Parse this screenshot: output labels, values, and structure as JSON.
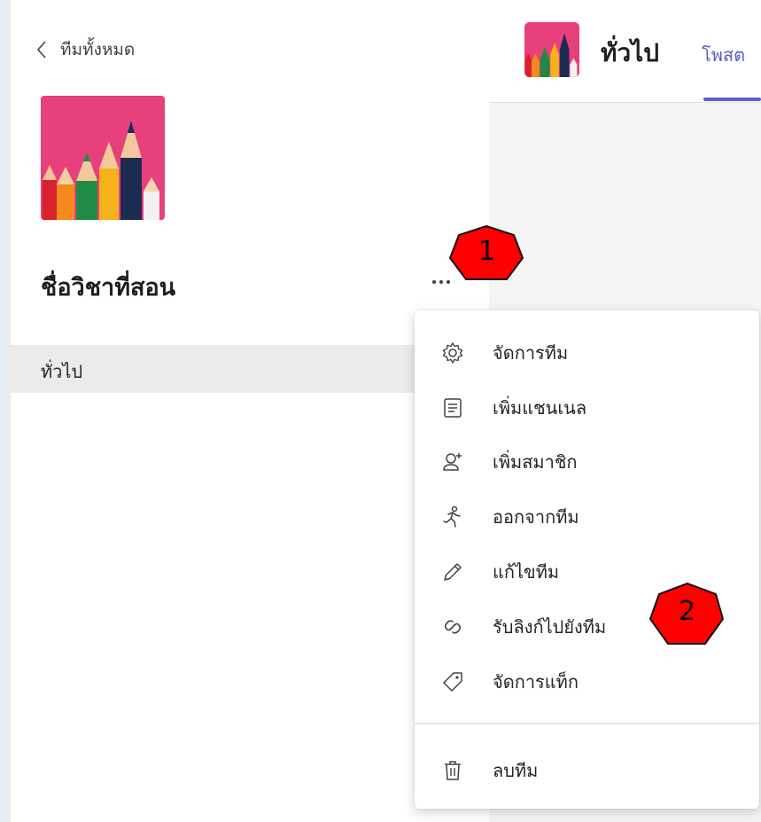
{
  "sidebar": {
    "back_label": "ทีมทั้งหมด",
    "team_name": "ชื่อวิชาที่สอน",
    "channels": [
      {
        "label": "ทั่วไป"
      }
    ]
  },
  "header": {
    "channel_title": "ทั่วไป",
    "tab_posts": "โพสต"
  },
  "menu": {
    "items": [
      {
        "label": "จัดการทีม",
        "icon": "gear-icon"
      },
      {
        "label": "เพิ่มแชนเนล",
        "icon": "channel-list-icon"
      },
      {
        "label": "เพิ่มสมาชิก",
        "icon": "add-person-icon"
      },
      {
        "label": "ออกจากทีม",
        "icon": "leave-run-icon"
      },
      {
        "label": "แก้ไขทีม",
        "icon": "pencil-icon"
      },
      {
        "label": "รับลิงก์ไปยังทีม",
        "icon": "link-icon"
      },
      {
        "label": "จัดการแท็ก",
        "icon": "tag-icon"
      },
      {
        "label": "ลบทีม",
        "icon": "trash-icon"
      }
    ]
  },
  "callouts": [
    {
      "number": "1"
    },
    {
      "number": "2"
    }
  ],
  "colors": {
    "accent": "#5b5fc7",
    "callout_red": "#ff0000",
    "team_image_bg": "#e83f7d"
  }
}
